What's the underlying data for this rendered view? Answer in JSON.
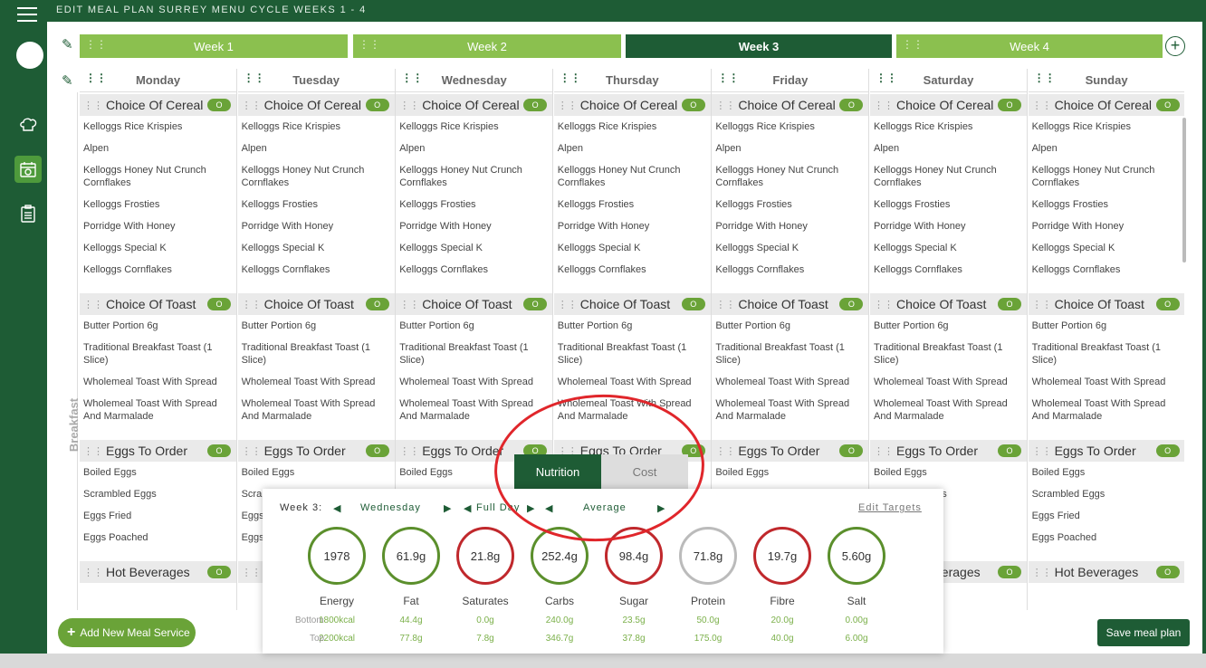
{
  "header": {
    "title": "EDIT MEAL PLAN SURREY MENU CYCLE WEEKS 1 - 4"
  },
  "weeks": [
    "Week 1",
    "Week 2",
    "Week 3",
    "Week 4"
  ],
  "active_week": "Week 3",
  "days": [
    "Monday",
    "Tuesday",
    "Wednesday",
    "Thursday",
    "Friday",
    "Saturday",
    "Sunday"
  ],
  "meal_service": "Breakfast",
  "categories": {
    "cereal": {
      "label": "Choice Of Cereal",
      "badge": "O",
      "items": [
        "Kelloggs Rice Krispies",
        "Alpen",
        "Kelloggs Honey Nut Crunch Cornflakes",
        "Kelloggs Frosties",
        "Porridge With Honey",
        "Kelloggs Special K",
        "Kelloggs Cornflakes"
      ]
    },
    "toast": {
      "label": "Choice Of Toast",
      "badge": "O",
      "items": [
        "Butter Portion 6g",
        "Traditional Breakfast Toast (1 Slice)",
        "Wholemeal Toast With Spread",
        "Wholemeal Toast With Spread And Marmalade"
      ]
    },
    "eggs": {
      "label": "Eggs To Order",
      "badge": "O",
      "items": [
        "Boiled Eggs",
        "Scrambled Eggs",
        "Eggs Fried",
        "Eggs Poached"
      ]
    },
    "bev": {
      "label": "Hot Beverages",
      "badge": "O"
    }
  },
  "buttons": {
    "add_meal_service": "Add New Meal Service",
    "save": "Save meal plan"
  },
  "nutrition": {
    "tabs": {
      "nutrition": "Nutrition",
      "cost": "Cost"
    },
    "week_label": "Week 3:",
    "day": "Wednesday",
    "period": "Full Day",
    "mode": "Average",
    "edit_targets": "Edit Targets",
    "row_bottom": "Bottom",
    "row_top": "Top",
    "metrics": [
      {
        "name": "Energy",
        "value": "1978",
        "bottom": "1800kcal",
        "top": "2200kcal",
        "status": "green"
      },
      {
        "name": "Fat",
        "value": "61.9g",
        "bottom": "44.4g",
        "top": "77.8g",
        "status": "green"
      },
      {
        "name": "Saturates",
        "value": "21.8g",
        "bottom": "0.0g",
        "top": "7.8g",
        "status": "red"
      },
      {
        "name": "Carbs",
        "value": "252.4g",
        "bottom": "240.0g",
        "top": "346.7g",
        "status": "green"
      },
      {
        "name": "Sugar",
        "value": "98.4g",
        "bottom": "23.5g",
        "top": "37.8g",
        "status": "red"
      },
      {
        "name": "Protein",
        "value": "71.8g",
        "bottom": "50.0g",
        "top": "175.0g",
        "status": "green"
      },
      {
        "name": "Fibre",
        "value": "19.7g",
        "bottom": "20.0g",
        "top": "40.0g",
        "status": "red"
      },
      {
        "name": "Salt",
        "value": "5.60g",
        "bottom": "0.00g",
        "top": "6.00g",
        "status": "green"
      }
    ]
  },
  "colors": {
    "primary": "#1e5c35",
    "accent": "#8bc04f",
    "badge": "#6aa338",
    "warn": "#c0282c"
  }
}
